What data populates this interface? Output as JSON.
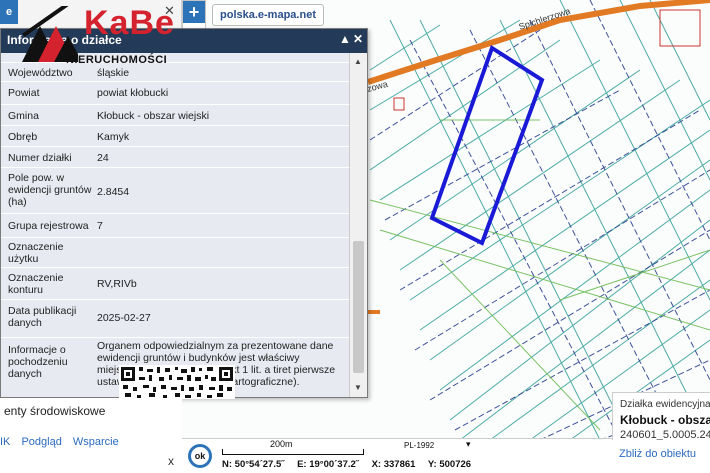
{
  "app": {
    "site": "polska.e-mapa.net"
  },
  "logo": {
    "name": "KaBe",
    "subtitle": "NIERUCHOMOŚCI"
  },
  "info_panel": {
    "title": "Informacja o działce",
    "rows": [
      {
        "key": "Województwo",
        "value": "śląskie"
      },
      {
        "key": "Powiat",
        "value": "powiat kłobucki"
      },
      {
        "key": "Gmina",
        "value": "Kłobuck - obszar wiejski"
      },
      {
        "key": "Obręb",
        "value": "Kamyk"
      },
      {
        "key": "Numer działki",
        "value": "24"
      },
      {
        "key": "Pole pow. w ewidencji gruntów (ha)",
        "value": "2.8454"
      },
      {
        "key": "Grupa rejestrowa",
        "value": "7"
      },
      {
        "key": "Oznaczenie użytku",
        "value": ""
      },
      {
        "key": "Oznaczenie konturu",
        "value": "RV,RIVb"
      },
      {
        "key": "Data publikacji danych",
        "value": "2025-02-27"
      },
      {
        "key": "Informacje o pochodzeniu danych",
        "value": "Organem odpowiedzialnym za prezentowane dane ewidencji gruntów i budynków jest właściwy miejscowo starosta (art. 7d pkt 1 lit. a tiret pierwsze ustawy Prawo geodezyjne i kartograficzne)."
      }
    ]
  },
  "sidebar": {
    "tab_label": "e",
    "env_text": "enty środowiskowe",
    "links": [
      "IK",
      "Podgląd",
      "Wsparcie"
    ]
  },
  "map": {
    "road_label": "Spichlerzowa",
    "road_label_2": "zowa",
    "parcel_color": "#1a1ad6"
  },
  "status": {
    "ok": "ok",
    "scale": "200m",
    "crs": "PL-1992",
    "crs_arrow": "▾",
    "lat": "N: 50°54´27.5˝",
    "lon": "E: 19°00´37.2˝",
    "x": "X: 337861",
    "y": "Y: 500726"
  },
  "parcel_card": {
    "line1": "Działka ewidencyjna",
    "line2": "Kłobuck - obszar wiejski",
    "line3": "240601_5.0005.24",
    "link": "Zbliż do obiektu"
  }
}
